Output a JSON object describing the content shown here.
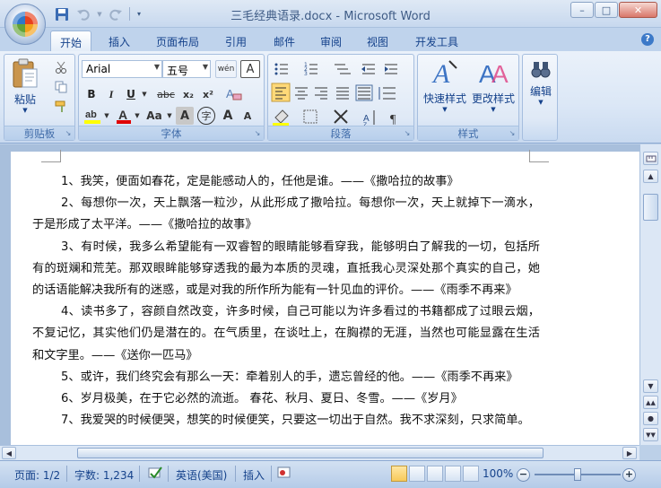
{
  "window": {
    "title": "三毛经典语录.docx - Microsoft Word",
    "min_label": "–",
    "max_label": "□",
    "close_label": "✕"
  },
  "tabs": [
    "开始",
    "插入",
    "页面布局",
    "引用",
    "邮件",
    "审阅",
    "视图",
    "开发工具"
  ],
  "ribbon": {
    "clipboard": {
      "paste": "粘贴",
      "label": "剪贴板"
    },
    "font": {
      "name": "Arial",
      "size": "五号",
      "label": "字体",
      "bold": "B",
      "italic": "I",
      "underline": "U",
      "strike": "abc",
      "sub": "x₂",
      "sup": "x²",
      "wen": "wén",
      "char_border": "A",
      "clear": "A",
      "aa": "Aa",
      "shade": "A",
      "enclose": "字",
      "grow": "A",
      "shrink": "A"
    },
    "paragraph": {
      "label": "段落"
    },
    "styles": {
      "quick": "快速样式",
      "change": "更改样式",
      "label": "样式"
    },
    "editing": {
      "label": "编辑"
    }
  },
  "document": {
    "paragraphs": [
      "1、我笑，便面如春花，定是能感动人的，任他是谁。——《撒哈拉的故事》",
      "2、每想你一次，天上飘落一粒沙，从此形成了撒哈拉。每想你一次，天上就掉下一滴水，于是形成了太平洋。——《撒哈拉的故事》",
      "3、有时候，我多么希望能有一双睿智的眼睛能够看穿我，能够明白了解我的一切，包括所有的斑斓和荒芜。那双眼眸能够穿透我的最为本质的灵魂，直抵我心灵深处那个真实的自己，她的话语能解决我所有的迷惑，或是对我的所作所为能有一针见血的评价。——《雨季不再来》",
      "4、读书多了，容颜自然改变，许多时候，自己可能以为许多看过的书籍都成了过眼云烟，不复记忆，其实他们仍是潜在的。在气质里，在谈吐上，在胸襟的无涯，当然也可能显露在生活和文字里。——《送你一匹马》",
      "5、或许，我们终究会有那么一天：牵着别人的手，遗忘曾经的他。——《雨季不再来》",
      "6、岁月极美，在于它必然的流逝。 春花、秋月、夏日、冬雪。——《岁月》",
      "7、我爱哭的时候便哭，想笑的时候便笑，只要这一切出于自然。我不求深刻，只求简单。"
    ]
  },
  "statusbar": {
    "page": "页面: 1/2",
    "words": "字数: 1,234",
    "language": "英语(美国)",
    "insert": "插入",
    "zoom": "100%",
    "zoom_minus": "−",
    "zoom_plus": "+"
  }
}
